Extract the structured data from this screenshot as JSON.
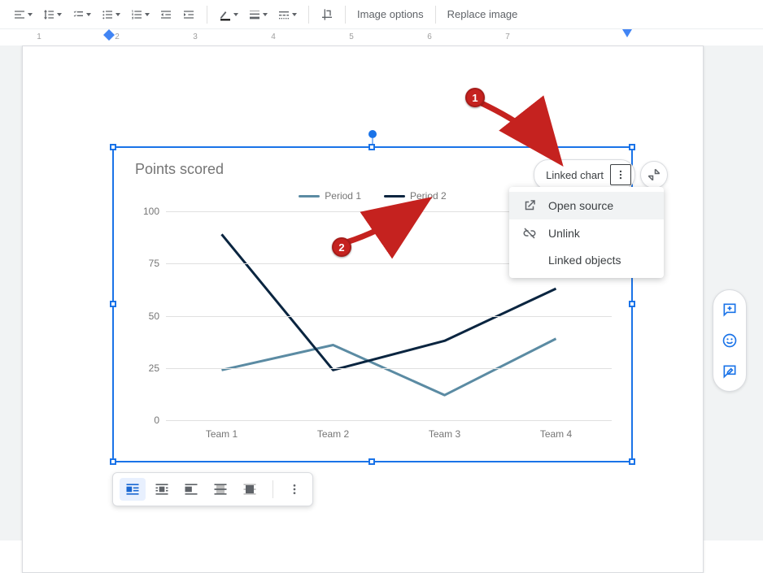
{
  "toolbar": {
    "image_options": "Image options",
    "replace_image": "Replace image"
  },
  "ruler": {
    "nums": [
      "1",
      "2",
      "3",
      "4",
      "5",
      "6",
      "7"
    ]
  },
  "linked_chip": {
    "label": "Linked chart"
  },
  "popup": {
    "open_source": "Open source",
    "unlink": "Unlink",
    "linked_objects": "Linked objects"
  },
  "annotations": {
    "b1": "1",
    "b2": "2"
  },
  "chart_data": {
    "type": "line",
    "title": "Points scored",
    "categories": [
      "Team 1",
      "Team 2",
      "Team 3",
      "Team 4"
    ],
    "series": [
      {
        "name": "Period 1",
        "color": "#5b8ba3",
        "values": [
          24,
          36,
          12,
          39
        ]
      },
      {
        "name": "Period 2",
        "color": "#0a2540",
        "values": [
          89,
          24,
          38,
          63
        ]
      }
    ],
    "yticks": [
      0,
      25,
      50,
      75,
      100
    ],
    "ylim": [
      0,
      100
    ]
  }
}
